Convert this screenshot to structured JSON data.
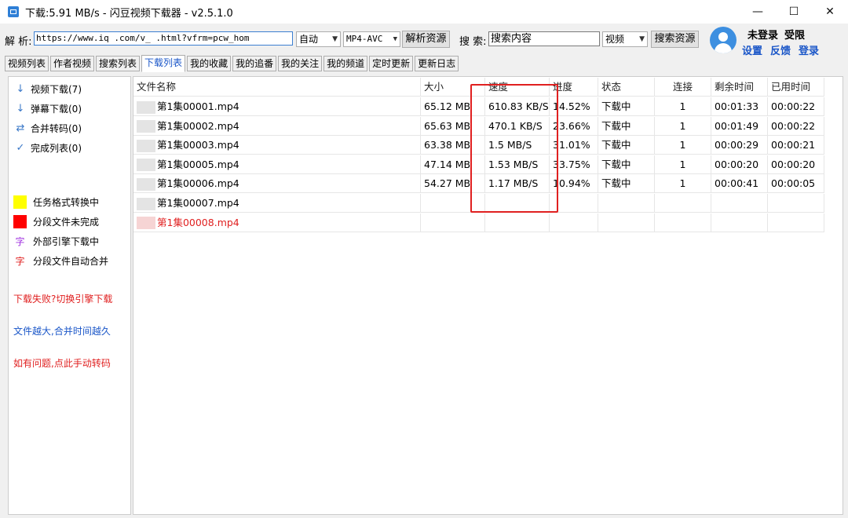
{
  "window": {
    "title": "下载:5.91 MB/s - 闪豆视频下载器 - v2.5.1.0",
    "min": "—",
    "max": "☐",
    "close": "✕"
  },
  "toolbar": {
    "parse_label": "解 析:",
    "url_value": "https://www.iq  .com/v_    .html?vfrm=pcw_hom",
    "auto_select": "自动",
    "format_select": "MP4-AVC",
    "parse_button": "解析资源",
    "search_label": "搜 索:",
    "search_value": "搜索内容",
    "type_select": "视频",
    "search_button": "搜索资源"
  },
  "user": {
    "status": "未登录",
    "vip": "受限",
    "settings": "设置",
    "feedback": "反馈",
    "login": "登录"
  },
  "tabs": [
    "视频列表",
    "作者视频",
    "搜索列表",
    "下载列表",
    "我的收藏",
    "我的追番",
    "我的关注",
    "我的频道",
    "定时更新",
    "更新日志"
  ],
  "active_tab": 3,
  "sidebar": {
    "items": [
      {
        "label": "视频下载(7)"
      },
      {
        "label": "弹幕下载(0)"
      },
      {
        "label": "合并转码(0)"
      },
      {
        "label": "完成列表(0)"
      }
    ],
    "legend": [
      {
        "label": "任务格式转换中",
        "color": "#ffff00"
      },
      {
        "label": "分段文件未完成",
        "color": "#ff0000"
      },
      {
        "label": "外部引擎下载中",
        "char": "字",
        "color": "#a030e0"
      },
      {
        "label": "分段文件自动合并",
        "char": "字",
        "color": "#e02020"
      }
    ],
    "links": [
      {
        "label": "下载失败?切换引擎下载",
        "color": "#e02020"
      },
      {
        "label": "文件越大,合并时间越久",
        "color": "#1a56c8"
      },
      {
        "label": "如有问题,点此手动转码",
        "color": "#e02020"
      }
    ]
  },
  "table": {
    "columns": [
      "文件名称",
      "大小",
      "速度",
      "进度",
      "状态",
      "连接",
      "剩余时间",
      "已用时间"
    ],
    "rows": [
      {
        "name": "第1集00001.mp4",
        "size": "65.12 MB",
        "speed": "610.83 KB/S",
        "progress": "14.52%",
        "status": "下载中",
        "conn": "1",
        "remain": "00:01:33",
        "used": "00:00:22"
      },
      {
        "name": "第1集00002.mp4",
        "size": "65.63 MB",
        "speed": "470.1 KB/S",
        "progress": "23.66%",
        "status": "下载中",
        "conn": "1",
        "remain": "00:01:49",
        "used": "00:00:22"
      },
      {
        "name": "第1集00003.mp4",
        "size": "63.38 MB",
        "speed": "1.5 MB/S",
        "progress": "31.01%",
        "status": "下载中",
        "conn": "1",
        "remain": "00:00:29",
        "used": "00:00:21"
      },
      {
        "name": "第1集00005.mp4",
        "size": "47.14 MB",
        "speed": "1.53 MB/S",
        "progress": "33.75%",
        "status": "下载中",
        "conn": "1",
        "remain": "00:00:20",
        "used": "00:00:20"
      },
      {
        "name": "第1集00006.mp4",
        "size": "54.27 MB",
        "speed": "1.17 MB/S",
        "progress": "10.94%",
        "status": "下载中",
        "conn": "1",
        "remain": "00:00:41",
        "used": "00:00:05"
      },
      {
        "name": "第1集00007.mp4",
        "size": "",
        "speed": "",
        "progress": "",
        "status": "",
        "conn": "",
        "remain": "",
        "used": ""
      },
      {
        "name": "第1集00008.mp4",
        "size": "",
        "speed": "",
        "progress": "",
        "status": "",
        "conn": "",
        "remain": "",
        "used": "",
        "red": true
      }
    ]
  }
}
